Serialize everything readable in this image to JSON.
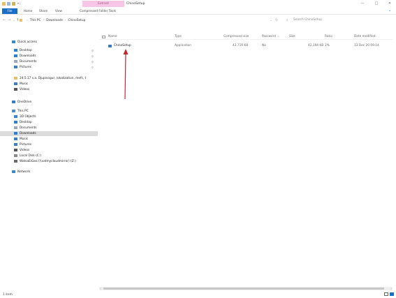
{
  "window": {
    "title": "ChinoSetup",
    "context_tab": "Extract",
    "controls": {
      "minimize": "—",
      "maximize": "□",
      "close": "✕"
    }
  },
  "ribbon": {
    "tabs": [
      "File",
      "Home",
      "Share",
      "View",
      "Compressed Folder Tools"
    ]
  },
  "address": {
    "breadcrumbs": [
      "This PC",
      "Downloads",
      "ChinoSetup"
    ],
    "search_placeholder": "Search ChinoSetup"
  },
  "nav": {
    "items": [
      {
        "label": "Quick access",
        "icon": "star-icon",
        "color": "#3a88d4",
        "pinned": false,
        "selected": false
      },
      {
        "label": "Desktop",
        "icon": "desktop-icon",
        "color": "#2b7fd4",
        "pinned": true,
        "selected": false
      },
      {
        "label": "Downloads",
        "icon": "download-icon",
        "color": "#2b7fd4",
        "pinned": true,
        "selected": false
      },
      {
        "label": "Documents",
        "icon": "documents-icon",
        "color": "#9aa8b8",
        "pinned": true,
        "selected": false
      },
      {
        "label": "Pictures",
        "icon": "pictures-icon",
        "color": "#3a7fc8",
        "pinned": true,
        "selected": false
      },
      {
        "label": "24.5.17 s.a. Djupivogur, lokalizatiun, mefs, t",
        "icon": "folder-icon",
        "color": "#e8c062",
        "pinned": false,
        "selected": false
      },
      {
        "label": "Music",
        "icon": "music-icon",
        "color": "#3a7fc8",
        "pinned": false,
        "selected": false
      },
      {
        "label": "Videos",
        "icon": "videos-icon",
        "color": "#555555",
        "pinned": false,
        "selected": false
      },
      {
        "label": "OneDrive",
        "icon": "cloud-icon",
        "color": "#2f7cd0",
        "pinned": false,
        "selected": false
      },
      {
        "label": "This PC",
        "icon": "computer-icon",
        "color": "#4a90d0",
        "pinned": false,
        "selected": false
      },
      {
        "label": "3D Objects",
        "icon": "cube-icon",
        "color": "#3a88d4",
        "pinned": false,
        "selected": false
      },
      {
        "label": "Desktop",
        "icon": "desktop-icon",
        "color": "#2b7fd4",
        "pinned": false,
        "selected": false
      },
      {
        "label": "Documents",
        "icon": "documents-icon",
        "color": "#9aa8b8",
        "pinned": false,
        "selected": false
      },
      {
        "label": "Downloads",
        "icon": "download-icon",
        "color": "#2b7fd4",
        "pinned": false,
        "selected": true
      },
      {
        "label": "Music",
        "icon": "music-icon",
        "color": "#3a7fc8",
        "pinned": false,
        "selected": false
      },
      {
        "label": "Pictures",
        "icon": "pictures-icon",
        "color": "#3a7fc8",
        "pinned": false,
        "selected": false
      },
      {
        "label": "Videos",
        "icon": "videos-icon",
        "color": "#555555",
        "pinned": false,
        "selected": false
      },
      {
        "label": "Local Disk (C:)",
        "icon": "drive-icon",
        "color": "#8a8a8a",
        "pinned": false,
        "selected": false
      },
      {
        "label": "WatsaEiGea (\\\\vatmycloudmirror) (Z:)",
        "icon": "network-drive-icon",
        "color": "#6a6a6a",
        "pinned": false,
        "selected": false
      },
      {
        "label": "Network",
        "icon": "network-icon",
        "color": "#3a88d4",
        "pinned": false,
        "selected": false
      }
    ]
  },
  "columns": [
    "Name",
    "Type",
    "Compressed size",
    "Password ...",
    "Size",
    "Ratio",
    "Date modified"
  ],
  "rows": [
    {
      "name": "ChinoSetup",
      "type": "Application",
      "compressed_size": "42,719 KB",
      "password": "No",
      "size": "42,194 KB",
      "ratio": "2%",
      "date": "13 Dec 20 09:14"
    }
  ],
  "status": {
    "items": "1 item"
  }
}
